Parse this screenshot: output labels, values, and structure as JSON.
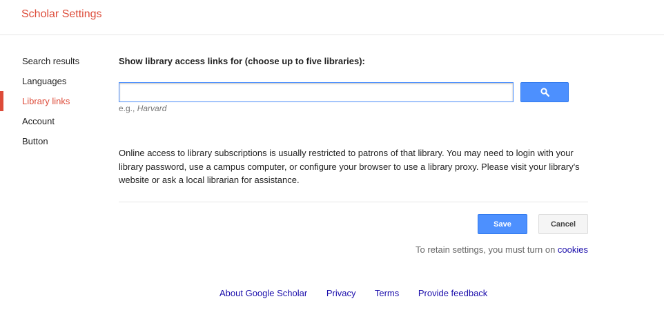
{
  "header": {
    "title": "Scholar Settings"
  },
  "nav": {
    "items": [
      {
        "label": "Search results"
      },
      {
        "label": "Languages"
      },
      {
        "label": "Library links"
      },
      {
        "label": "Account"
      },
      {
        "label": "Button"
      }
    ],
    "active_index": 2
  },
  "main": {
    "heading": "Show library access links for (choose up to five libraries):",
    "search_input": {
      "value": "",
      "placeholder": ""
    },
    "search_button_icon": "search-icon",
    "hint_prefix": "e.g., ",
    "hint_example": "Harvard",
    "description": "Online access to library subscriptions is usually restricted to patrons of that library. You may need to login with your library password, use a campus computer, or configure your browser to use a library proxy. Please visit your library's website or ask a local librarian for assistance.",
    "save_label": "Save",
    "cancel_label": "Cancel",
    "retain_text": "To retain settings, you must turn on ",
    "cookies_link": "cookies"
  },
  "footer": {
    "links": [
      "About Google Scholar",
      "Privacy",
      "Terms",
      "Provide feedback"
    ]
  },
  "colors": {
    "accent_red": "#dd4b39",
    "button_blue": "#4d90fe",
    "link_blue": "#1a0dab"
  }
}
